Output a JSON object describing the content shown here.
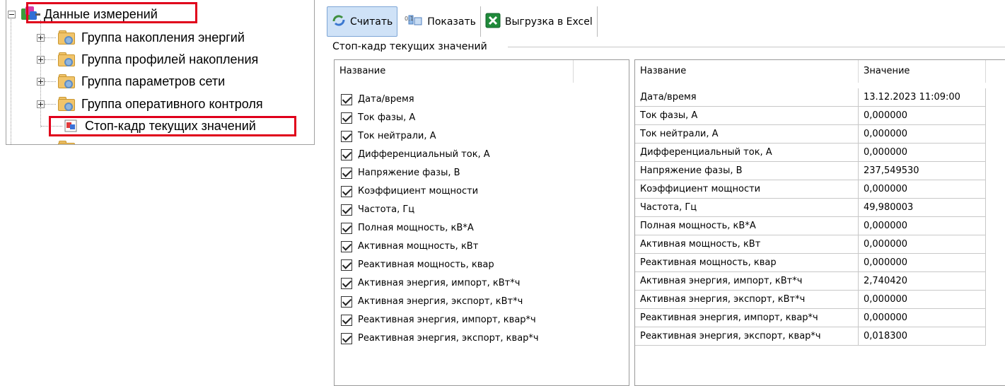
{
  "tree": {
    "root": {
      "label": "Данные измерений",
      "icon": "data-measurements-icon"
    },
    "children": [
      {
        "label": "Группа накопления энергий",
        "icon": "folder-gear-icon"
      },
      {
        "label": "Группа профилей накопления",
        "icon": "folder-gear-icon"
      },
      {
        "label": "Группа параметров сети",
        "icon": "folder-gear-icon"
      },
      {
        "label": "Группа оперативного контроля",
        "icon": "folder-gear-icon"
      },
      {
        "label": "Стоп-кадр текущих значений",
        "icon": "snapshot-icon",
        "selected": true
      }
    ]
  },
  "toolbar": {
    "read_label": "Считать",
    "show_label": "Показать",
    "excel_label": "Выгрузка в Excel"
  },
  "group_title": "Стоп-кадр текущих значений",
  "left_grid": {
    "header": "Название",
    "rows": [
      "Дата/время",
      "Ток фазы, А",
      "Ток нейтрали, А",
      "Дифференциальный ток, А",
      "Напряжение фазы, В",
      "Коэффициент мощности",
      "Частота, Гц",
      "Полная мощность, кВ*А",
      "Активная мощность, кВт",
      "Реактивная мощность, квар",
      "Активная энергия, импорт, кВт*ч",
      "Активная энергия, экспорт, кВт*ч",
      "Реактивная энергия, импорт, квар*ч",
      "Реактивная энергия, экспорт, квар*ч"
    ]
  },
  "right_grid": {
    "headers": {
      "name": "Название",
      "value": "Значение"
    },
    "rows": [
      {
        "name": "Дата/время",
        "value": "13.12.2023 11:09:00"
      },
      {
        "name": "Ток фазы, А",
        "value": "0,000000"
      },
      {
        "name": "Ток нейтрали, А",
        "value": "0,000000"
      },
      {
        "name": "Дифференциальный ток, А",
        "value": "0,000000"
      },
      {
        "name": "Напряжение фазы, В",
        "value": "237,549530"
      },
      {
        "name": "Коэффициент мощности",
        "value": "0,000000"
      },
      {
        "name": "Частота, Гц",
        "value": "49,980003"
      },
      {
        "name": "Полная мощность, кВ*А",
        "value": "0,000000"
      },
      {
        "name": "Активная мощность, кВт",
        "value": "0,000000"
      },
      {
        "name": "Реактивная мощность, квар",
        "value": "0,000000"
      },
      {
        "name": "Активная энергия, импорт, кВт*ч",
        "value": "2,740420"
      },
      {
        "name": "Активная энергия, экспорт, кВт*ч",
        "value": "0,000000"
      },
      {
        "name": "Реактивная энергия, импорт, квар*ч",
        "value": "0,000000"
      },
      {
        "name": "Реактивная энергия, экспорт, квар*ч",
        "value": "0,018300"
      }
    ]
  },
  "colors": {
    "highlight": "#e0001b",
    "pressed_button": "#cfe2f7"
  }
}
